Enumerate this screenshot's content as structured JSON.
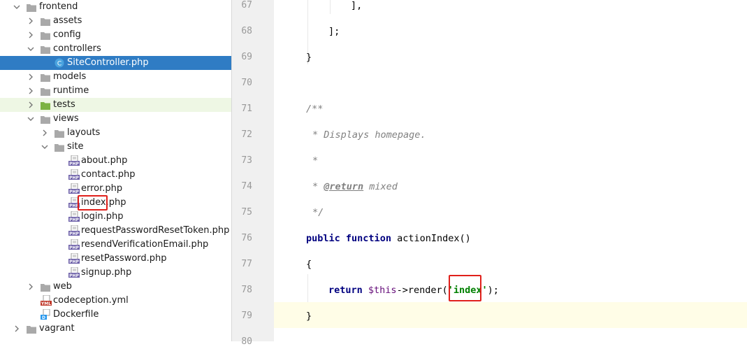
{
  "tree": {
    "items": [
      {
        "label": "frontend"
      },
      {
        "label": "assets"
      },
      {
        "label": "config"
      },
      {
        "label": "controllers"
      },
      {
        "label": "SiteController.php"
      },
      {
        "label": "models"
      },
      {
        "label": "runtime"
      },
      {
        "label": "tests"
      },
      {
        "label": "views"
      },
      {
        "label": "layouts"
      },
      {
        "label": "site"
      },
      {
        "label": "about.php"
      },
      {
        "label": "contact.php"
      },
      {
        "label": "error.php"
      },
      {
        "label": "index.php"
      },
      {
        "label": "login.php"
      },
      {
        "label": "requestPasswordResetToken.php"
      },
      {
        "label": "resendVerificationEmail.php"
      },
      {
        "label": "resetPassword.php"
      },
      {
        "label": "signup.php"
      },
      {
        "label": "web"
      },
      {
        "label": "codeception.yml"
      },
      {
        "label": "Dockerfile"
      },
      {
        "label": "vagrant"
      }
    ],
    "php_badge": "PHP",
    "yml_badge": "YML",
    "class_badge": "C",
    "docker_badge": "D"
  },
  "editor": {
    "line_numbers": [
      "67",
      "68",
      "69",
      "70",
      "71",
      "72",
      "73",
      "74",
      "75",
      "76",
      "77",
      "78",
      "79",
      "80"
    ],
    "lines": {
      "l67": "],",
      "l68": "];",
      "l69": "}",
      "l71": "/**",
      "l72": "* Displays homepage.",
      "l73": "*",
      "l74_star": "* ",
      "l74_tag": "@return",
      "l74_rest": " mixed",
      "l75": "*/",
      "l76_kw1": "public",
      "l76_kw2": "function",
      "l76_rest": " actionIndex()",
      "l77": "{",
      "l78_kw": "return",
      "l78_var": "$this",
      "l78_mid": "->render(",
      "l78_q1": "'",
      "l78_str": "index",
      "l78_q2": "'",
      "l78_end": ");",
      "l79": "}"
    },
    "current_line": "79"
  },
  "colors": {
    "selection": "#2f7cc4",
    "highlight_row": "#eef7e4",
    "annotation_red": "#e0201b",
    "folder": "#a9a9a9",
    "test_folder": "#7cb342"
  }
}
